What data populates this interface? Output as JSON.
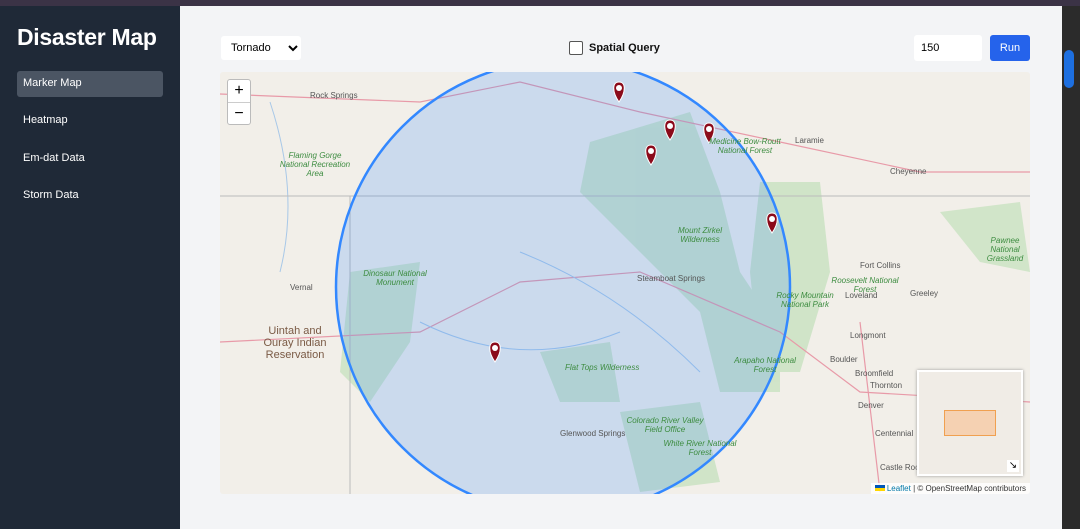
{
  "sidebar": {
    "title": "Disaster Map",
    "items": [
      {
        "label": "Marker Map",
        "active": true
      },
      {
        "label": "Heatmap"
      },
      {
        "label": "Em-dat Data"
      },
      {
        "label": "Storm Data"
      }
    ]
  },
  "controls": {
    "disaster_type": "Tornado",
    "spatial_query_label": "Spatial Query",
    "spatial_query_checked": false,
    "radius_value": "150",
    "run_label": "Run"
  },
  "map": {
    "zoom_in": "+",
    "zoom_out": "−",
    "attribution_leaflet": "Leaflet",
    "attribution_rest": "| © OpenStreetMap contributors",
    "circle_color": "#3388ff",
    "marker_color": "#8b0a1a",
    "places": [
      "Rock Springs",
      "Flaming Gorge National Recreation Area",
      "Laramie",
      "Cheyenne",
      "Medicine Bow-Routt National Forest",
      "Mount Zirkel Wilderness",
      "Dinosaur National Monument",
      "Vernal",
      "Steamboat Springs",
      "Pawnee National Grassland",
      "Fort Collins",
      "Loveland",
      "Greeley",
      "Roosevelt National Forest",
      "Rocky Mountain National Park",
      "Longmont",
      "Uintah and Ouray Indian Reservation",
      "Flat Tops Wilderness",
      "Arapaho National Forest",
      "Boulder",
      "Broomfield",
      "Thornton",
      "Denver",
      "Centennial",
      "Glenwood Springs",
      "Colorado River Valley Field Office",
      "White River National Forest",
      "Castle Rock"
    ]
  }
}
